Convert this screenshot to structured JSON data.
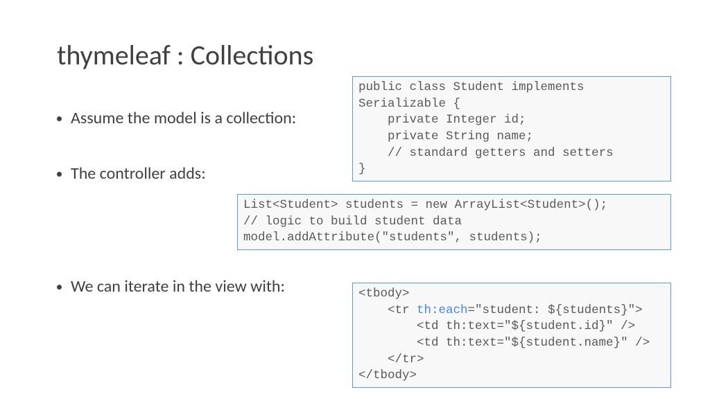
{
  "slide": {
    "title": "thymeleaf : Collections",
    "bullets": [
      "Assume the model is a collection:",
      "The controller adds:",
      "We can iterate in the view with:"
    ]
  },
  "code": {
    "box1": "public class Student implements Serializable {\n    private Integer id;\n    private String name;\n    // standard getters and setters\n}",
    "box2": "List<Student> students = new ArrayList<Student>();\n// logic to build student data\nmodel.addAttribute(\"students\", students);",
    "box3_pre": "<tbody>\n    <tr ",
    "box3_kw": "th:each",
    "box3_post": "=\"student: ${students}\">\n        <td th:text=\"${student.id}\" />\n        <td th:text=\"${student.name}\" />\n    </tr>\n</tbody>"
  }
}
